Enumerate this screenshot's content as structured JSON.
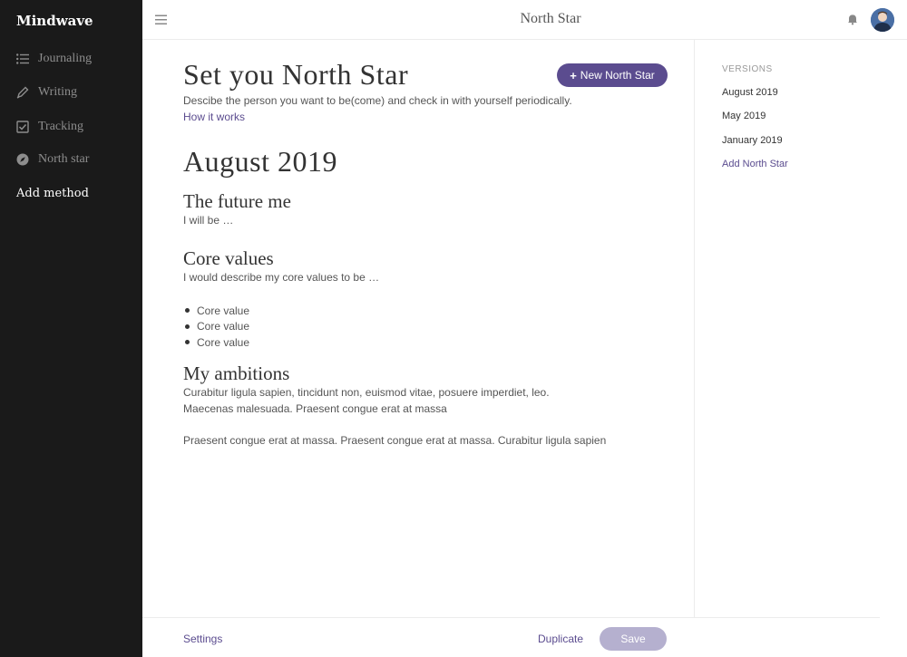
{
  "app": {
    "brand": "Mindwave"
  },
  "sidebar": {
    "items": [
      {
        "label": "Journaling",
        "icon": "list-icon"
      },
      {
        "label": "Writing",
        "icon": "pen-icon"
      },
      {
        "label": "Tracking",
        "icon": "checkbox-icon"
      },
      {
        "label": "North star",
        "icon": "compass-icon"
      }
    ],
    "add_method": "Add method"
  },
  "header": {
    "title": "North Star"
  },
  "main": {
    "title": "Set you North Star",
    "new_button": "New North Star",
    "description": "Descibe the person you want to be(come) and check in with yourself periodically.",
    "how_link": "How it works",
    "version_title": "August 2019",
    "future": {
      "heading": "The future me",
      "text": "I will be …"
    },
    "core_values": {
      "heading": "Core values",
      "text": "I would describe my core values to be …",
      "items": [
        "Core value",
        "Core value",
        "Core value"
      ]
    },
    "ambitions": {
      "heading": "My ambitions",
      "paragraph1": "Curabitur ligula sapien, tincidunt non, euismod vitae, posuere imperdiet, leo. Maecenas malesuada. Praesent congue erat at massa",
      "paragraph2": "Praesent congue erat at massa. Praesent congue erat at massa. Curabitur ligula sapien"
    }
  },
  "versions": {
    "label": "VERSIONS",
    "items": [
      "August 2019",
      "May 2019",
      "January 2019"
    ],
    "add": "Add North Star"
  },
  "footer": {
    "settings": "Settings",
    "duplicate": "Duplicate",
    "save": "Save"
  },
  "colors": {
    "sidebar": "#1a1a1a",
    "accent": "#5b4c8f",
    "save_disabled": "#b5b0cf"
  }
}
